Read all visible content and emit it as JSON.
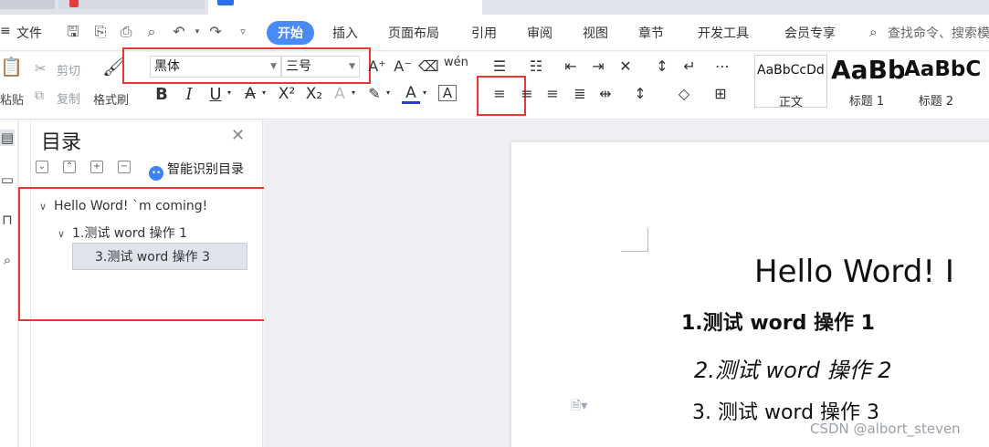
{
  "menu": {
    "file": "文件",
    "tabs": [
      "开始",
      "插入",
      "页面布局",
      "引用",
      "审阅",
      "视图",
      "章节",
      "开发工具",
      "会员专享"
    ],
    "search_placeholder": "查找命令、搜索模"
  },
  "ribbon": {
    "clipboard": {
      "cut": "剪切",
      "copy": "复制",
      "paste": "粘贴",
      "format_painter": "格式刷"
    },
    "font_name": "黑体",
    "font_size": "三号",
    "styles": [
      {
        "sample": "AaBbCcDd",
        "label": "正文"
      },
      {
        "sample": "AaBb",
        "label": "标题 1"
      },
      {
        "sample": "AaBbC",
        "label": "标题 2"
      }
    ]
  },
  "toc": {
    "title": "目录",
    "smart_button": "智能识别目录",
    "items": [
      {
        "label": "Hello Word!  `m coming!",
        "level": 0,
        "selected": false
      },
      {
        "label": "1.测试 word 操作 1",
        "level": 1,
        "selected": false
      },
      {
        "label": "3.测试 word 操作 3",
        "level": 2,
        "selected": true
      }
    ]
  },
  "document": {
    "heading_title": "Hello Word!   I",
    "heading_1": "1.测试 word 操作 1",
    "heading_2": "2.测试 word 操作 2",
    "heading_3": "3. 测试 word 操作 3"
  },
  "watermark": "CSDN @albort_steven",
  "colors": {
    "accent": "#4a8af4",
    "highlight_box": "#e33333"
  }
}
